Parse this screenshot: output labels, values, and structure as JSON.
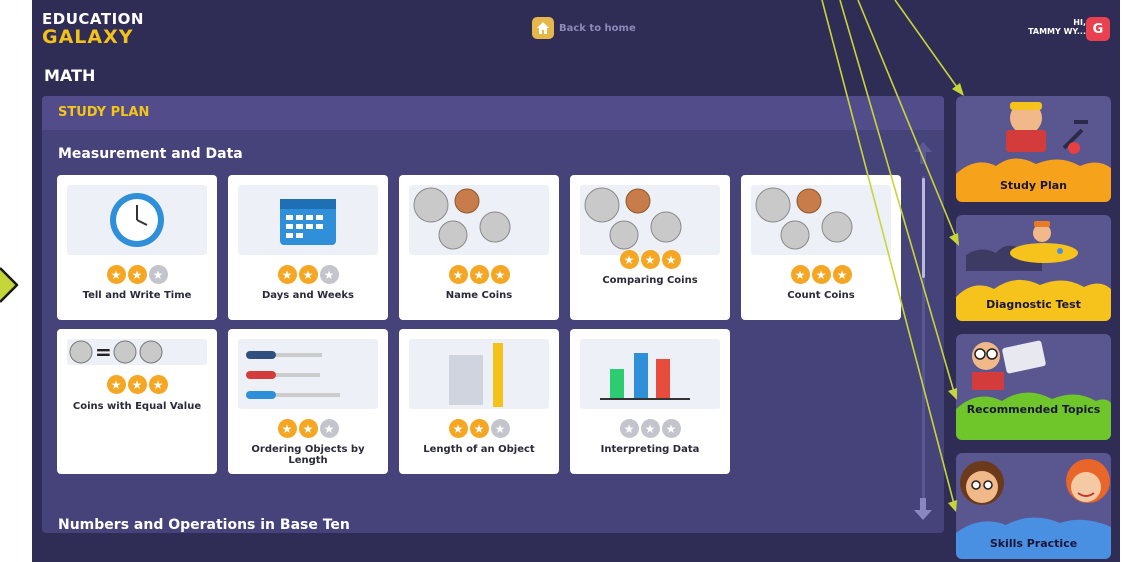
{
  "header": {
    "logo_line1": "EDUCATION",
    "logo_line2": "GALAXY",
    "back_label": "Back to home",
    "user_line1": "HI,",
    "user_line2": "TAMMY WY...",
    "logout_glyph": "G"
  },
  "section_title": "MATH",
  "study_plan": {
    "header": "STUDY PLAN",
    "groups": [
      {
        "title": "Measurement and Data",
        "cards": [
          {
            "title": "Tell and Write Time",
            "stars_earned": 2,
            "stars_total": 3,
            "icon": "clock-icon"
          },
          {
            "title": "Days and Weeks",
            "stars_earned": 2,
            "stars_total": 3,
            "icon": "calendar-icon"
          },
          {
            "title": "Name Coins",
            "stars_earned": 3,
            "stars_total": 3,
            "icon": "coins-icon"
          },
          {
            "title": "Comparing Coins",
            "stars_earned": 3,
            "stars_total": 3,
            "icon": "coins-icon"
          },
          {
            "title": "Count Coins",
            "stars_earned": 3,
            "stars_total": 3,
            "icon": "coins-icon"
          },
          {
            "title": "Coins with Equal Value",
            "stars_earned": 3,
            "stars_total": 3,
            "icon": "coins-equal-icon"
          },
          {
            "title": "Ordering Objects by Length",
            "stars_earned": 2,
            "stars_total": 3,
            "icon": "screwdrivers-icon"
          },
          {
            "title": "Length of an Object",
            "stars_earned": 2,
            "stars_total": 3,
            "icon": "ruler-icon"
          },
          {
            "title": "Interpreting Data",
            "stars_earned": 0,
            "stars_total": 3,
            "icon": "bar-chart-icon"
          }
        ]
      },
      {
        "title": "Numbers and Operations in Base Ten",
        "cards": []
      }
    ]
  },
  "side_tiles": [
    {
      "label": "Study Plan",
      "color": "#f7a21b"
    },
    {
      "label": "Diagnostic Test",
      "color": "#f6c31c"
    },
    {
      "label": "Recommended Topics",
      "color": "#6fc62a"
    },
    {
      "label": "Skills Practice",
      "color": "#4a90e2"
    }
  ],
  "colors": {
    "background": "#2f2c55",
    "panel": "#46427a",
    "accent": "#f5c518",
    "star": "#f5a623",
    "annotation": "#c5d63a"
  }
}
